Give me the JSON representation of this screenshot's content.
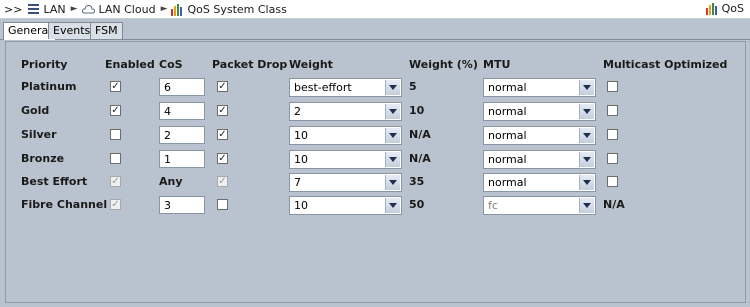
{
  "breadcrumb": {
    "prefix": ">>",
    "items": [
      {
        "label": "LAN",
        "icon": "list-icon"
      },
      {
        "label": "LAN Cloud",
        "icon": "cloud-icon"
      },
      {
        "label": "QoS System Class",
        "icon": "qos-icon"
      }
    ],
    "right_title": "QoS"
  },
  "tabs": [
    {
      "label": "General",
      "active": true
    },
    {
      "label": "Events",
      "active": false
    },
    {
      "label": "FSM",
      "active": false
    }
  ],
  "table": {
    "headers": {
      "priority": "Priority",
      "enabled": "Enabled",
      "cos": "CoS",
      "packet_drop": "Packet Drop",
      "weight": "Weight",
      "weight_pct": "Weight (%)",
      "mtu": "MTU",
      "multicast": "Multicast Optimized"
    },
    "rows": [
      {
        "priority": "Platinum",
        "enabled": true,
        "enabled_disabled": false,
        "cos": "6",
        "cos_editable": true,
        "packet_drop": true,
        "packet_drop_disabled": false,
        "weight": "best-effort",
        "weight_pct": "5",
        "mtu": "normal",
        "mtu_disabled": false,
        "multicast": false,
        "multicast_shown": true,
        "multicast_text": ""
      },
      {
        "priority": "Gold",
        "enabled": true,
        "enabled_disabled": false,
        "cos": "4",
        "cos_editable": true,
        "packet_drop": true,
        "packet_drop_disabled": false,
        "weight": "2",
        "weight_pct": "10",
        "mtu": "normal",
        "mtu_disabled": false,
        "multicast": false,
        "multicast_shown": true,
        "multicast_text": ""
      },
      {
        "priority": "Silver",
        "enabled": false,
        "enabled_disabled": false,
        "cos": "2",
        "cos_editable": true,
        "packet_drop": true,
        "packet_drop_disabled": false,
        "weight": "10",
        "weight_pct": "N/A",
        "mtu": "normal",
        "mtu_disabled": false,
        "multicast": false,
        "multicast_shown": true,
        "multicast_text": ""
      },
      {
        "priority": "Bronze",
        "enabled": false,
        "enabled_disabled": false,
        "cos": "1",
        "cos_editable": true,
        "packet_drop": true,
        "packet_drop_disabled": false,
        "weight": "10",
        "weight_pct": "N/A",
        "mtu": "normal",
        "mtu_disabled": false,
        "multicast": false,
        "multicast_shown": true,
        "multicast_text": ""
      },
      {
        "priority": "Best Effort",
        "enabled": true,
        "enabled_disabled": true,
        "cos": "Any",
        "cos_editable": false,
        "packet_drop": true,
        "packet_drop_disabled": true,
        "weight": "7",
        "weight_pct": "35",
        "mtu": "normal",
        "mtu_disabled": false,
        "multicast": false,
        "multicast_shown": true,
        "multicast_text": ""
      },
      {
        "priority": "Fibre Channel",
        "enabled": true,
        "enabled_disabled": true,
        "cos": "3",
        "cos_editable": true,
        "packet_drop": false,
        "packet_drop_disabled": false,
        "weight": "10",
        "weight_pct": "50",
        "mtu": "fc",
        "mtu_disabled": true,
        "multicast": false,
        "multicast_shown": false,
        "multicast_text": "N/A"
      }
    ]
  },
  "colors": {
    "panel_bg": "#b9c3cf",
    "check_mark": "#202020"
  }
}
